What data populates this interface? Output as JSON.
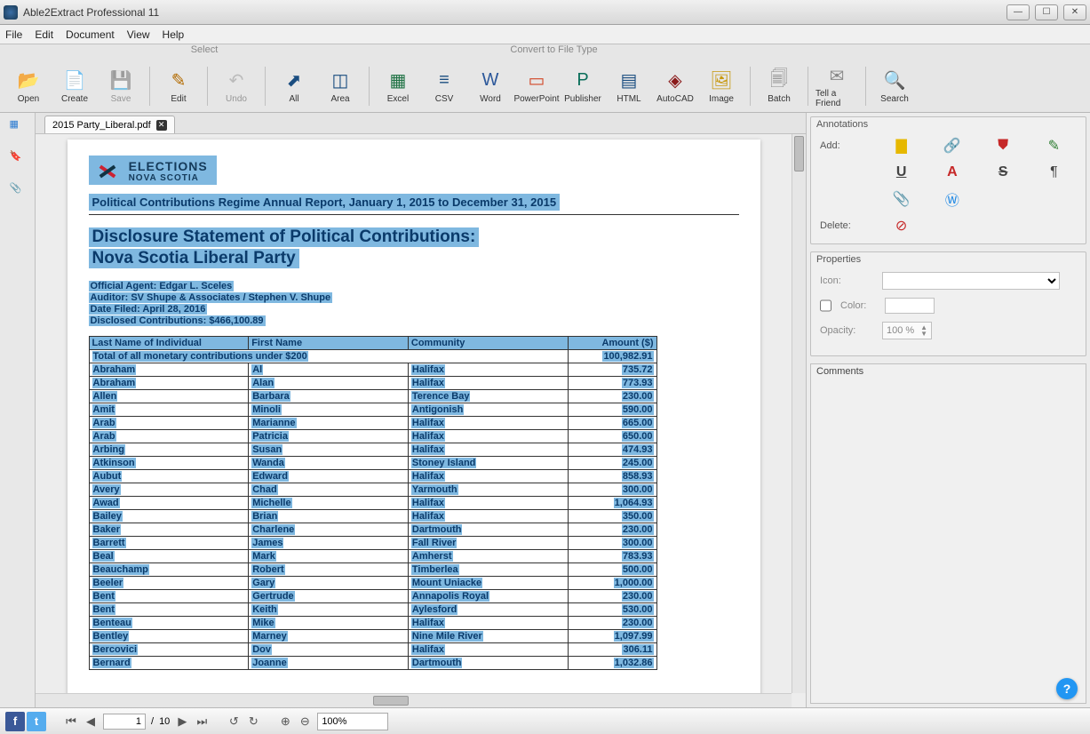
{
  "window": {
    "title": "Able2Extract Professional 11"
  },
  "menu": {
    "items": [
      "File",
      "Edit",
      "Document",
      "View",
      "Help"
    ]
  },
  "toolbar": {
    "group_select_label": "Select",
    "group_convert_label": "Convert to File Type",
    "buttons": {
      "open": "Open",
      "create": "Create",
      "save": "Save",
      "edit": "Edit",
      "undo": "Undo",
      "all": "All",
      "area": "Area",
      "excel": "Excel",
      "csv": "CSV",
      "word": "Word",
      "powerpoint": "PowerPoint",
      "publisher": "Publisher",
      "html": "HTML",
      "autocad": "AutoCAD",
      "image": "Image",
      "batch": "Batch",
      "tell": "Tell a Friend",
      "search": "Search"
    }
  },
  "tab": {
    "filename": "2015 Party_Liberal.pdf"
  },
  "document": {
    "logo_top": "ELECTIONS",
    "logo_bottom": "NOVA SCOTIA",
    "report_title": "Political Contributions Regime Annual Report, January 1, 2015 to December 31, 2015",
    "heading1": "Disclosure Statement of Political Contributions:",
    "heading2": "Nova Scotia Liberal Party",
    "meta": [
      "Official Agent: Edgar L. Sceles",
      "Auditor:  SV Shupe & Associates / Stephen V. Shupe",
      "Date Filed: April 28, 2016",
      "Disclosed Contributions: $466,100.89"
    ],
    "columns": [
      "Last Name of Individual",
      "First Name",
      "Community",
      "Amount ($)"
    ],
    "total_row": {
      "label": "Total of all monetary contributions under $200",
      "amount": "100,982.91"
    },
    "rows": [
      {
        "last": "Abraham",
        "first": "Al",
        "community": "Halifax",
        "amount": "735.72"
      },
      {
        "last": "Abraham",
        "first": "Alan",
        "community": "Halifax",
        "amount": "773.93"
      },
      {
        "last": "Allen",
        "first": "Barbara",
        "community": "Terence Bay",
        "amount": "230.00"
      },
      {
        "last": "Amit",
        "first": "Minoli",
        "community": "Antigonish",
        "amount": "590.00"
      },
      {
        "last": "Arab",
        "first": "Marianne",
        "community": "Halifax",
        "amount": "665.00"
      },
      {
        "last": "Arab",
        "first": "Patricia",
        "community": "Halifax",
        "amount": "650.00"
      },
      {
        "last": "Arbing",
        "first": "Susan",
        "community": "Halifax",
        "amount": "474.93"
      },
      {
        "last": "Atkinson",
        "first": "Wanda",
        "community": "Stoney Island",
        "amount": "245.00"
      },
      {
        "last": "Aubut",
        "first": "Edward",
        "community": "Halifax",
        "amount": "858.93"
      },
      {
        "last": "Avery",
        "first": "Chad",
        "community": "Yarmouth",
        "amount": "300.00"
      },
      {
        "last": "Awad",
        "first": "Michelle",
        "community": "Halifax",
        "amount": "1,064.93"
      },
      {
        "last": "Bailey",
        "first": "Brian",
        "community": "Halifax",
        "amount": "350.00"
      },
      {
        "last": "Baker",
        "first": "Charlene",
        "community": "Dartmouth",
        "amount": "230.00"
      },
      {
        "last": "Barrett",
        "first": "James",
        "community": "Fall River",
        "amount": "300.00"
      },
      {
        "last": "Beal",
        "first": "Mark",
        "community": "Amherst",
        "amount": "783.93"
      },
      {
        "last": "Beauchamp",
        "first": "Robert",
        "community": "Timberlea",
        "amount": "500.00"
      },
      {
        "last": "Beeler",
        "first": "Gary",
        "community": "Mount Uniacke",
        "amount": "1,000.00"
      },
      {
        "last": "Bent",
        "first": "Gertrude",
        "community": "Annapolis Royal",
        "amount": "230.00"
      },
      {
        "last": "Bent",
        "first": "Keith",
        "community": "Aylesford",
        "amount": "530.00"
      },
      {
        "last": "Benteau",
        "first": "Mike",
        "community": "Halifax",
        "amount": "230.00"
      },
      {
        "last": "Bentley",
        "first": "Marney",
        "community": "Nine Mile River",
        "amount": "1,097.99"
      },
      {
        "last": "Bercovici",
        "first": "Dov",
        "community": "Halifax",
        "amount": "306.11"
      },
      {
        "last": "Bernard",
        "first": "Joanne",
        "community": "Dartmouth",
        "amount": "1,032.86"
      }
    ]
  },
  "annotations": {
    "title": "Annotations",
    "add_label": "Add:",
    "delete_label": "Delete:",
    "icons": [
      "sticky-note",
      "link",
      "stamp",
      "highlighter",
      "underline",
      "text-color",
      "strikethrough",
      "paragraph",
      "attachment",
      "watermark"
    ]
  },
  "properties": {
    "title": "Properties",
    "icon_label": "Icon:",
    "color_label": "Color:",
    "opacity_label": "Opacity:",
    "opacity_value": "100 %"
  },
  "comments": {
    "title": "Comments"
  },
  "statusbar": {
    "page_current": "1",
    "page_sep": "/",
    "page_total": "10",
    "zoom": "100%"
  }
}
